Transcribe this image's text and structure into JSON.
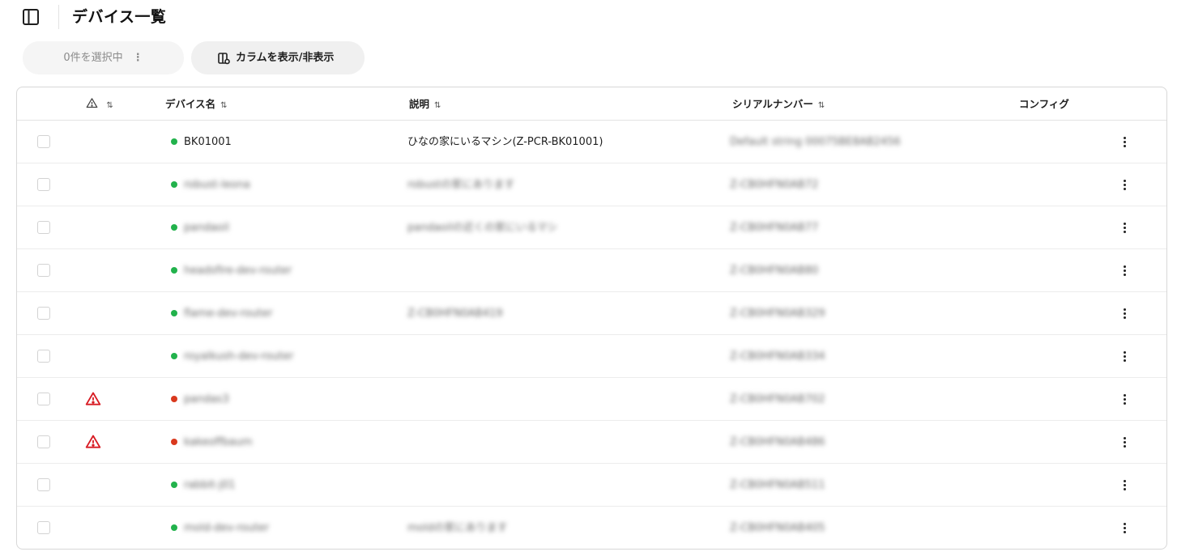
{
  "header": {
    "title": "デバイス一覧"
  },
  "toolbar": {
    "selected_label": "0件を選択中",
    "columns_label": "カラムを表示/非表示"
  },
  "table": {
    "columns": {
      "warning": "",
      "name": "デバイス名",
      "description": "説明",
      "serial": "シリアルナンバー",
      "config": "コンフィグ"
    },
    "sort_glyph": "⇅",
    "rows": [
      {
        "warning": false,
        "status": "online",
        "name": "BK01001",
        "description": "ひなの家にいるマシン(Z-PCR-BK01001)",
        "serial": "Default string 00075BE8AB2456",
        "name_blurred": false,
        "desc_blurred": false,
        "serial_blurred": true
      },
      {
        "warning": false,
        "status": "online",
        "name": "robust-leona",
        "description": "robustの家にあります",
        "serial": "Z-CB0HFN0AB72",
        "name_blurred": true,
        "desc_blurred": true,
        "serial_blurred": true
      },
      {
        "warning": false,
        "status": "online",
        "name": "pandaoil",
        "description": "pandaoilの近くの家にいるマシ",
        "serial": "Z-CB0HFN0AB77",
        "name_blurred": true,
        "desc_blurred": true,
        "serial_blurred": true
      },
      {
        "warning": false,
        "status": "online",
        "name": "headsfire-dev-router",
        "description": "",
        "serial": "Z-CB0HFN0AB80",
        "name_blurred": true,
        "desc_blurred": true,
        "serial_blurred": true
      },
      {
        "warning": false,
        "status": "online",
        "name": "flame-dev-router",
        "description": "Z-CB0HFN0AB419",
        "serial": "Z-CB0HFN0AB329",
        "name_blurred": true,
        "desc_blurred": true,
        "serial_blurred": true
      },
      {
        "warning": false,
        "status": "online",
        "name": "royalkush-dev-router",
        "description": "",
        "serial": "Z-CB0HFN0AB334",
        "name_blurred": true,
        "desc_blurred": true,
        "serial_blurred": true
      },
      {
        "warning": true,
        "status": "error",
        "name": "pandas3",
        "description": "",
        "serial": "Z-CB0HFN0AB702",
        "name_blurred": true,
        "desc_blurred": true,
        "serial_blurred": true
      },
      {
        "warning": true,
        "status": "error",
        "name": "kakeoffbaum",
        "description": "",
        "serial": "Z-CB0HFN0AB486",
        "name_blurred": true,
        "desc_blurred": true,
        "serial_blurred": true
      },
      {
        "warning": false,
        "status": "online",
        "name": "rabbit-j01",
        "description": "",
        "serial": "Z-CB0HFN0AB511",
        "name_blurred": true,
        "desc_blurred": true,
        "serial_blurred": true
      },
      {
        "warning": false,
        "status": "online",
        "name": "mold-dev-router",
        "description": "moldの家にあります",
        "serial": "Z-CB0HFN0AB405",
        "name_blurred": true,
        "desc_blurred": true,
        "serial_blurred": true
      }
    ]
  },
  "colors": {
    "online": "#22b24c",
    "error": "#d9391e",
    "warning_icon": "#d81b23"
  },
  "icons": {
    "sidebar_toggle": "sidebar-toggle-icon",
    "columns": "columns-icon",
    "warning": "warning-triangle-icon",
    "more": "more-vertical-icon"
  }
}
